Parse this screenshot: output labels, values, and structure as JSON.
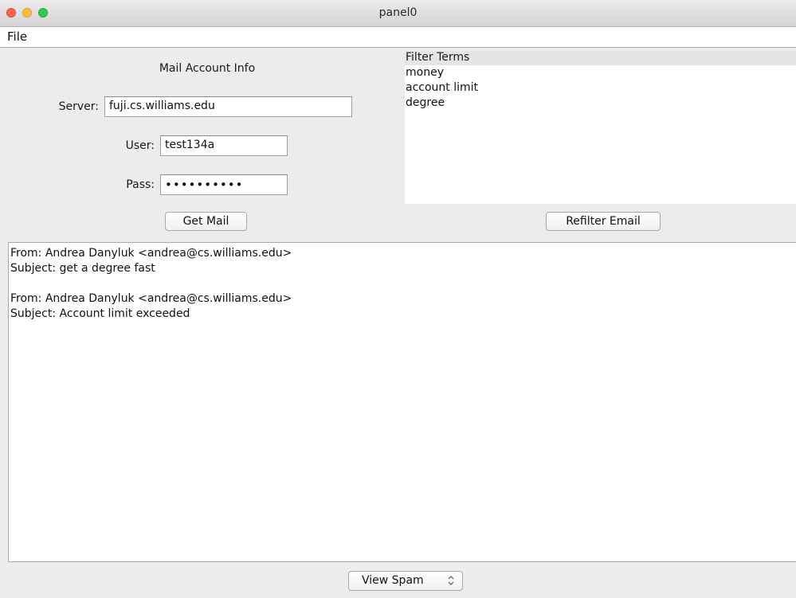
{
  "window": {
    "title": "panel0"
  },
  "menubar": {
    "file_label": "File"
  },
  "account_info": {
    "title": "Mail Account Info",
    "server_label": "Server:",
    "server_value": "fuji.cs.williams.edu",
    "user_label": "User:",
    "user_value": "test134a",
    "pass_label": "Pass:",
    "pass_value": "••••••••••",
    "get_mail_label": "Get Mail"
  },
  "filter": {
    "header": "Filter Terms",
    "terms": [
      "money",
      "account limit",
      "degree"
    ],
    "refilter_label": "Refilter Email"
  },
  "emails": [
    {
      "from": "From: Andrea Danyluk <andrea@cs.williams.edu>",
      "subject": "Subject: get a degree fast"
    },
    {
      "from": "From: Andrea Danyluk <andrea@cs.williams.edu>",
      "subject": "Subject: Account limit exceeded"
    }
  ],
  "view_select": {
    "selected": "View Spam"
  },
  "colors": {
    "close": "#fc605c",
    "minimize": "#fdbc40",
    "maximize": "#34c84a",
    "panel_bg": "#ececec"
  },
  "icons": {
    "close": "close-button-icon",
    "minimize": "minimize-button-icon",
    "maximize": "zoom-button-icon",
    "select": "updown-chevron-icon"
  }
}
